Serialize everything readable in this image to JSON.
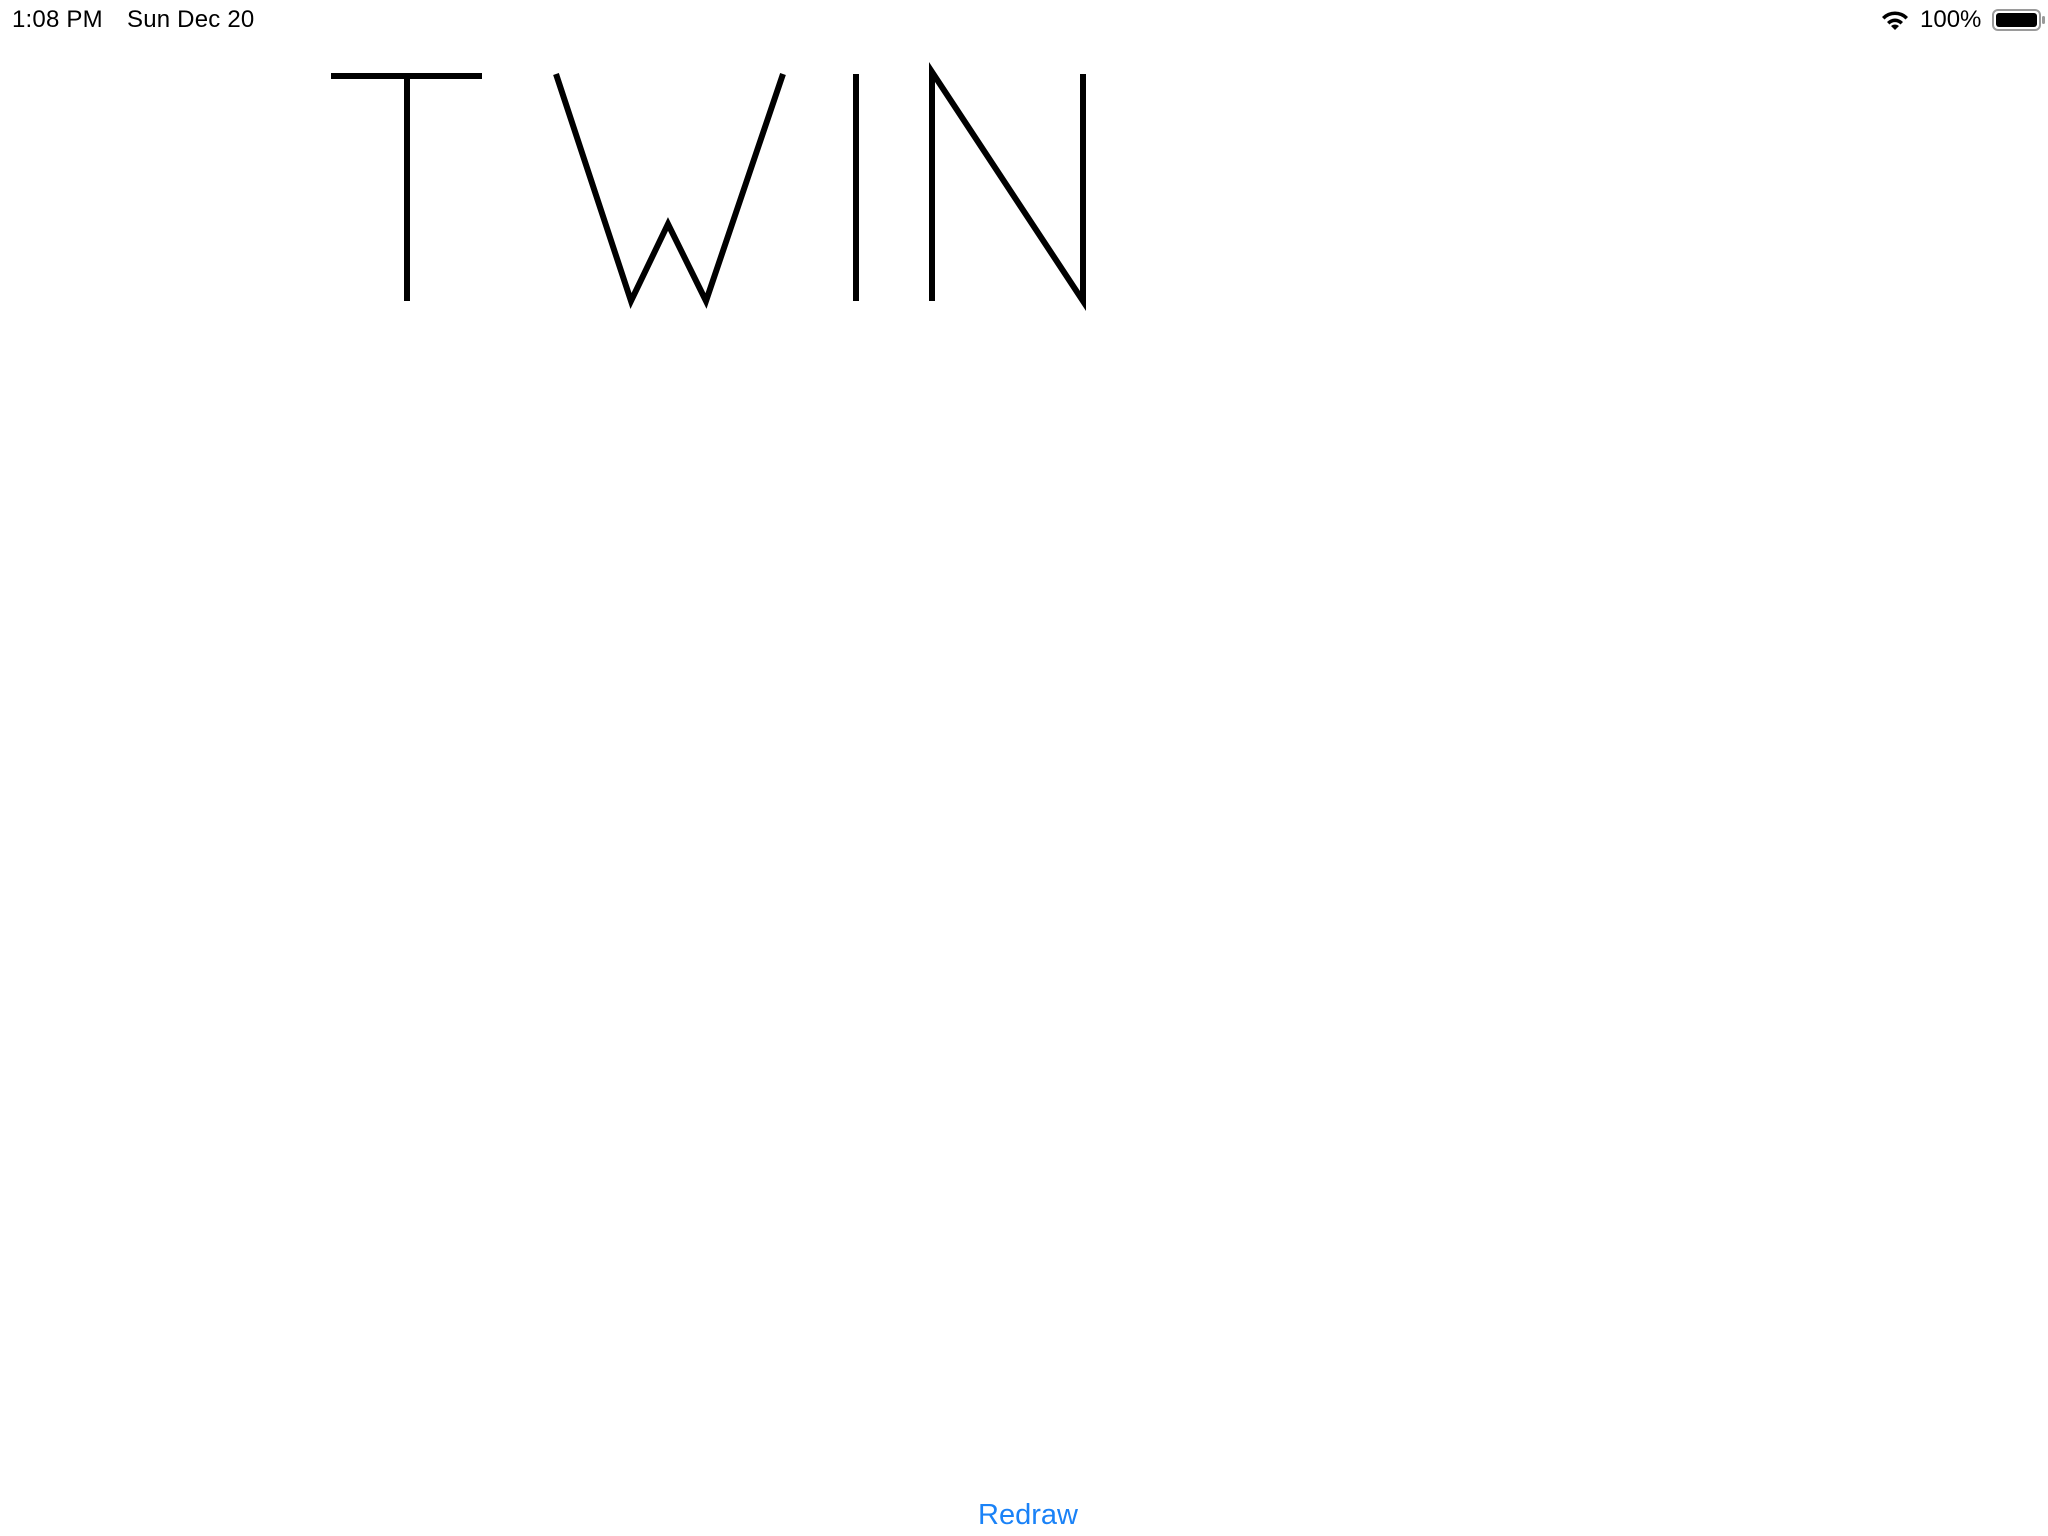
{
  "status_bar": {
    "time": "1:08 PM",
    "date": "Sun Dec 20",
    "battery_percent": "100%",
    "battery_level": 1.0,
    "icons": [
      "wifi-icon",
      "battery-icon"
    ]
  },
  "drawing": {
    "text": "TWIN",
    "stroke_color": "#000000"
  },
  "redraw_button": {
    "label": "Redraw",
    "color": "#1a82f7"
  }
}
